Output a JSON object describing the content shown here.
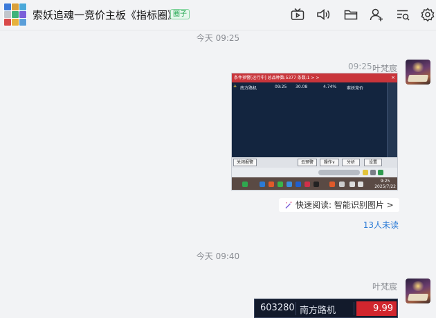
{
  "header": {
    "title": "索妖追魂一竞价主板《指标圈》",
    "badge": "圈子"
  },
  "messages": [
    {
      "separator": "今天 09:25",
      "time": "09:25",
      "sender": "叶梵宸",
      "screenshot": {
        "title_bar": "条件预警[运行中] 总品种数:5377 条数:1  > >",
        "close": "×",
        "row": {
          "icon": "≙",
          "name": "南方路机",
          "time": "09:25",
          "price": "30.08",
          "pct": "4.74%",
          "tag": "索妖竞价"
        },
        "buttons": {
          "close_alert": "关闭报警",
          "cloud_alert": "云预警",
          "operate": "操作∨",
          "analyze": "分析",
          "settings": "设置"
        },
        "clock_time": "9:25",
        "clock_date": "2025/7/22"
      },
      "quick_read": "快速阅读: 智能识别图片 >",
      "unread": "13人未读"
    },
    {
      "separator": "今天 09:40",
      "sender": "叶梵宸",
      "stock_card": {
        "code": "603280",
        "name": "南方路机",
        "price": "9.99"
      }
    }
  ],
  "icons": [
    "tv-icon",
    "speaker-icon",
    "folder-icon",
    "add-user-icon",
    "search-list-icon",
    "settings-icon"
  ],
  "colors": {
    "accent": "#2b7bd6",
    "price_up": "#d2262e",
    "badge": "#1aa34a"
  }
}
